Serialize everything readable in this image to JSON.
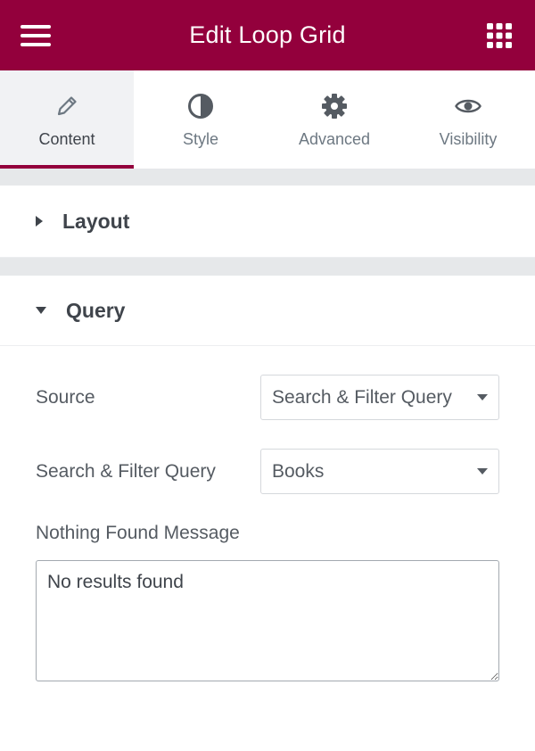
{
  "header": {
    "title": "Edit Loop Grid",
    "menu_icon": "hamburger-icon",
    "apps_icon": "grid-icon"
  },
  "tabs": [
    {
      "label": "Content",
      "icon": "pencil-icon",
      "active": true
    },
    {
      "label": "Style",
      "icon": "contrast-icon",
      "active": false
    },
    {
      "label": "Advanced",
      "icon": "gear-icon",
      "active": false
    },
    {
      "label": "Visibility",
      "icon": "eye-icon",
      "active": false
    }
  ],
  "sections": {
    "layout": {
      "title": "Layout",
      "expanded": false
    },
    "query": {
      "title": "Query",
      "expanded": true,
      "source_label": "Source",
      "source_value": "Search & Filter Query",
      "sf_query_label": "Search & Filter Query",
      "sf_query_value": "Books",
      "nothing_found_label": "Nothing Found Message",
      "nothing_found_value": "No results found"
    }
  },
  "colors": {
    "brand": "#93003c",
    "text": "#3f444b",
    "panel_bg": "#f1f2f4"
  }
}
